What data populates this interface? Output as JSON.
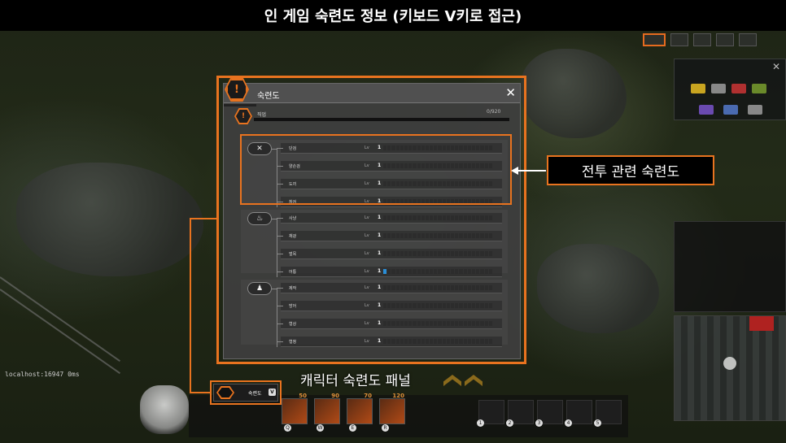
{
  "top_title": "인 게임 숙련도 정보 (키보드 V키로 접근)",
  "localhost_label": "localhost:16947 0ms",
  "panel": {
    "title": "숙련도",
    "header_icon": "!",
    "main_row": {
      "icon": "!",
      "label": "직업",
      "progress_text": "0/920",
      "progress": 0
    },
    "lv_label": "Lv",
    "groups": [
      {
        "name": "combat",
        "icon": "crossed-swords-icon",
        "icon_glyph": "✕",
        "rows": [
          {
            "name": "단검",
            "level": "1",
            "filled": 0
          },
          {
            "name": "양손검",
            "level": "1",
            "filled": 0
          },
          {
            "name": "도끼",
            "level": "1",
            "filled": 0
          },
          {
            "name": "창검",
            "level": "1",
            "filled": 0
          }
        ]
      },
      {
        "name": "gathering",
        "icon": "cooking-pot-icon",
        "icon_glyph": "♨",
        "rows": [
          {
            "name": "사냥",
            "level": "1",
            "filled": 0
          },
          {
            "name": "채광",
            "level": "1",
            "filled": 0
          },
          {
            "name": "벌목",
            "level": "1",
            "filled": 0
          },
          {
            "name": "어통",
            "level": "1",
            "filled": 1
          }
        ]
      },
      {
        "name": "crafting",
        "icon": "person-icon",
        "icon_glyph": "♟",
        "rows": [
          {
            "name": "제작",
            "level": "1",
            "filled": 0
          },
          {
            "name": "방어",
            "level": "1",
            "filled": 0
          },
          {
            "name": "형상",
            "level": "1",
            "filled": 0
          },
          {
            "name": "형청",
            "level": "1",
            "filled": 0
          }
        ]
      }
    ],
    "segments": 26
  },
  "callouts": {
    "combat": "전투 관련 숙련도",
    "panel": "캐릭터 숙련도 패널"
  },
  "mini_button": {
    "label": "숙련도",
    "key": "V"
  },
  "skills": [
    {
      "num": "50",
      "key": "Q"
    },
    {
      "num": "90",
      "key": "W"
    },
    {
      "num": "70",
      "key": "E"
    },
    {
      "num": "120",
      "key": "R"
    }
  ],
  "item_keys": [
    "1",
    "2",
    "3",
    "4",
    "5"
  ],
  "colors": {
    "accent": "#e8731f",
    "bar_fill": "#2a8ed6"
  }
}
